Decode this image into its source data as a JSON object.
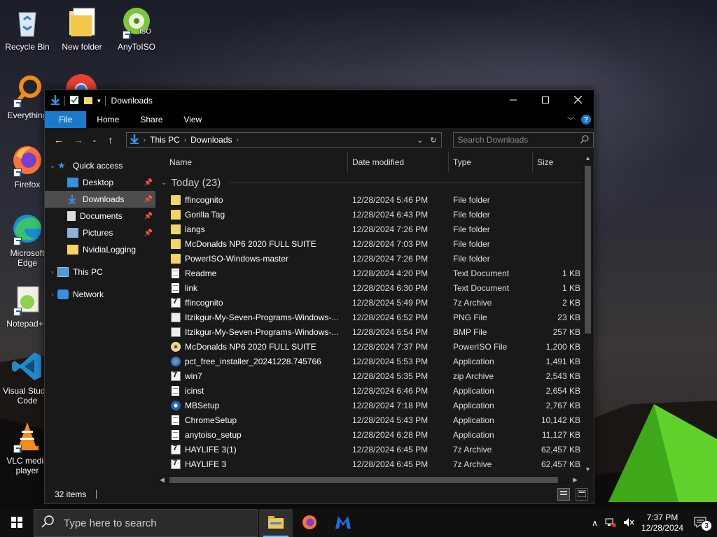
{
  "desktop": {
    "icons": [
      {
        "label": "Recycle Bin",
        "icon": "recycle-bin-icon"
      },
      {
        "label": "New folder",
        "icon": "folder-icon"
      },
      {
        "label": "AnyToISO",
        "icon": "anytoiso-icon"
      },
      {
        "label": "Everything",
        "icon": "everything-search-icon"
      },
      {
        "label": "Firefox",
        "icon": "firefox-icon"
      },
      {
        "label": "Microsoft Edge",
        "icon": "edge-icon"
      },
      {
        "label": "Notepad++",
        "icon": "notepad-plus-plus-icon"
      },
      {
        "label": "Visual Studio Code",
        "icon": "vscode-icon"
      },
      {
        "label": "VLC media player",
        "icon": "vlc-icon"
      }
    ]
  },
  "window": {
    "title": "Downloads",
    "ribbon": {
      "file": "File",
      "home": "Home",
      "share": "Share",
      "view": "View"
    },
    "breadcrumb": [
      "This PC",
      "Downloads"
    ],
    "search_placeholder": "Search Downloads",
    "columns": {
      "name": "Name",
      "date": "Date modified",
      "type": "Type",
      "size": "Size"
    },
    "group_label": "Today (23)",
    "nav": {
      "quick_access": "Quick access",
      "desktop": "Desktop",
      "downloads": "Downloads",
      "documents": "Documents",
      "pictures": "Pictures",
      "nvidialogging": "NvidiaLogging",
      "this_pc": "This PC",
      "network": "Network"
    },
    "status_items": "32 items",
    "files": [
      {
        "name": "ffincognito",
        "date": "12/28/2024 5:46 PM",
        "type": "File folder",
        "size": "",
        "icon": "folder"
      },
      {
        "name": "Gorilla Tag",
        "date": "12/28/2024 6:43 PM",
        "type": "File folder",
        "size": "",
        "icon": "folder"
      },
      {
        "name": "langs",
        "date": "12/28/2024 7:26 PM",
        "type": "File folder",
        "size": "",
        "icon": "folder"
      },
      {
        "name": "McDonalds NP6 2020 FULL SUITE",
        "date": "12/28/2024 7:03 PM",
        "type": "File folder",
        "size": "",
        "icon": "folder"
      },
      {
        "name": "PowerISO-Windows-master",
        "date": "12/28/2024 7:26 PM",
        "type": "File folder",
        "size": "",
        "icon": "folder"
      },
      {
        "name": "Readme",
        "date": "12/28/2024 4:20 PM",
        "type": "Text Document",
        "size": "1 KB",
        "icon": "doc"
      },
      {
        "name": "link",
        "date": "12/28/2024 6:30 PM",
        "type": "Text Document",
        "size": "1 KB",
        "icon": "doc"
      },
      {
        "name": "ffincognito",
        "date": "12/28/2024 5:49 PM",
        "type": "7z Archive",
        "size": "2 KB",
        "icon": "sevenz"
      },
      {
        "name": "Itzikgur-My-Seven-Programs-Windows-...",
        "date": "12/28/2024 6:52 PM",
        "type": "PNG File",
        "size": "23 KB",
        "icon": "img"
      },
      {
        "name": "Itzikgur-My-Seven-Programs-Windows-...",
        "date": "12/28/2024 6:54 PM",
        "type": "BMP File",
        "size": "257 KB",
        "icon": "img"
      },
      {
        "name": "McDonalds NP6 2020 FULL SUITE",
        "date": "12/28/2024 7:37 PM",
        "type": "PowerISO File",
        "size": "1,200 KB",
        "icon": "disc"
      },
      {
        "name": "pct_free_installer_20241228.745766",
        "date": "12/28/2024 5:53 PM",
        "type": "Application",
        "size": "1,491 KB",
        "icon": "app"
      },
      {
        "name": "win7",
        "date": "12/28/2024 5:35 PM",
        "type": "zip Archive",
        "size": "2,543 KB",
        "icon": "sevenz"
      },
      {
        "name": "icinst",
        "date": "12/28/2024 6:46 PM",
        "type": "Application",
        "size": "2,654 KB",
        "icon": "doc"
      },
      {
        "name": "MBSetup",
        "date": "12/28/2024 7:18 PM",
        "type": "Application",
        "size": "2,767 KB",
        "icon": "mb"
      },
      {
        "name": "ChromeSetup",
        "date": "12/28/2024 5:43 PM",
        "type": "Application",
        "size": "10,142 KB",
        "icon": "doc"
      },
      {
        "name": "anytoiso_setup",
        "date": "12/28/2024 6:28 PM",
        "type": "Application",
        "size": "11,127 KB",
        "icon": "doc"
      },
      {
        "name": "HAYLIFE 3(1)",
        "date": "12/28/2024 6:45 PM",
        "type": "7z Archive",
        "size": "62,457 KB",
        "icon": "sevenz"
      },
      {
        "name": "HAYLIFE 3",
        "date": "12/28/2024 6:45 PM",
        "type": "7z Archive",
        "size": "62,457 KB",
        "icon": "sevenz"
      }
    ]
  },
  "taskbar": {
    "search_placeholder": "Type here to search",
    "time": "7:37 PM",
    "date": "12/28/2024",
    "notification_count": "3"
  }
}
